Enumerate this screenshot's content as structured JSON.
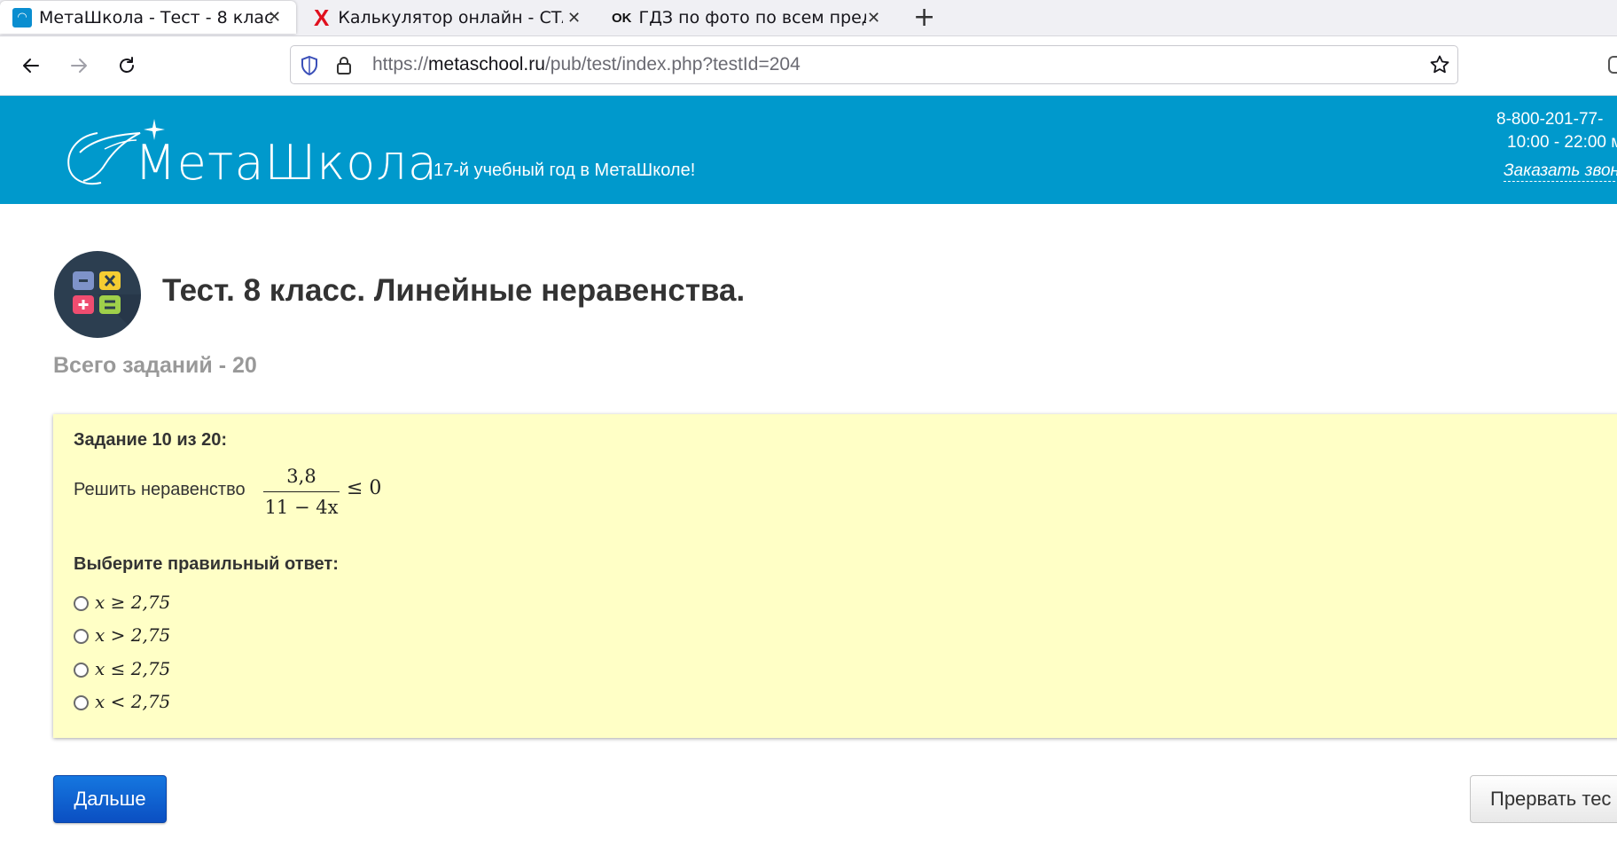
{
  "browser": {
    "tabs": [
      {
        "title": "МетаШкола - Тест - 8 клас",
        "favicon": "metaschool-favicon",
        "active": true
      },
      {
        "title": "Калькулятор онлайн - СТА",
        "favicon": "x-favicon",
        "active": false
      },
      {
        "title": "ГДЗ по фото по всем пред",
        "favicon": "ok-favicon",
        "active": false
      }
    ],
    "favicon_ok_text": "OK",
    "new_tab": "+",
    "url": {
      "scheme": "https://",
      "host": "metaschool.ru",
      "path": "/pub/test/index.php?testId=204"
    }
  },
  "site": {
    "logo": "МетаШкола",
    "tagline": "17-й учебный год в МетаШколе!",
    "phone": "8-800-201-77-",
    "hours": "10:00 - 22:00 м",
    "callback": "Заказать звон",
    "brand_color": "#0099cc"
  },
  "test": {
    "title": "Тест. 8 класс. Линейные неравенства.",
    "total": "Всего заданий - 20",
    "task": {
      "number": "Задание 10 из 20:",
      "prompt": "Решить неравенство",
      "fraction_numerator": "3,8",
      "fraction_denominator": "11 − 4x",
      "fraction_rest": "≤ 0",
      "choose_label": "Выберите правильный ответ:",
      "options": [
        "x ≥ 2,75",
        "x > 2,75",
        "x ≤ 2,75",
        "x < 2,75"
      ],
      "background": "#ffffc6"
    },
    "buttons": {
      "next": "Дальше",
      "abort": "Прервать тес"
    }
  }
}
